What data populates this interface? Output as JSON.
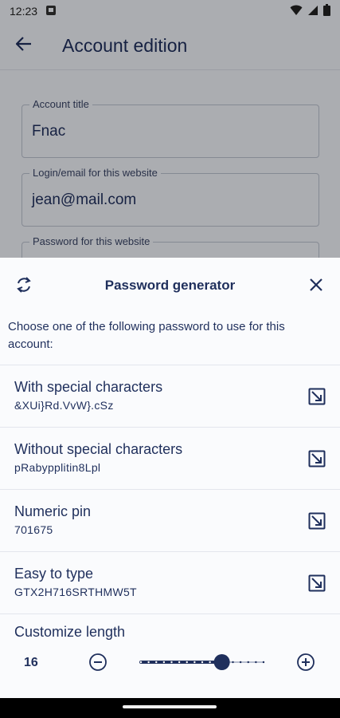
{
  "status_bar": {
    "time": "12:23"
  },
  "app_bar": {
    "title": "Account edition"
  },
  "form": {
    "fields": [
      {
        "label": "Account title",
        "value": "Fnac"
      },
      {
        "label": "Login/email for this website",
        "value": "jean@mail.com"
      },
      {
        "label": "Password for this website",
        "value": ""
      }
    ]
  },
  "sheet": {
    "title": "Password generator",
    "description": "Choose one of the following password to use for this account:",
    "options": [
      {
        "title": "With special characters",
        "value": "&XUi}Rd.VvW}.cSz"
      },
      {
        "title": "Without special characters",
        "value": "pRabypplitin8Lpl"
      },
      {
        "title": "Numeric pin",
        "value": "701675"
      },
      {
        "title": "Easy to type",
        "value": "GTX2H716SRTHMW5T"
      }
    ],
    "customize": {
      "label": "Customize length",
      "length": "16",
      "slider_fraction": 0.66
    }
  },
  "colors": {
    "primary": "#1f2f5c",
    "sheet_bg": "#fafbfd",
    "screen_bg": "#eef0f5"
  },
  "icons": [
    "back-arrow-icon",
    "refresh-icon",
    "close-icon",
    "use-password-icon",
    "minus-circle-icon",
    "plus-circle-icon"
  ]
}
